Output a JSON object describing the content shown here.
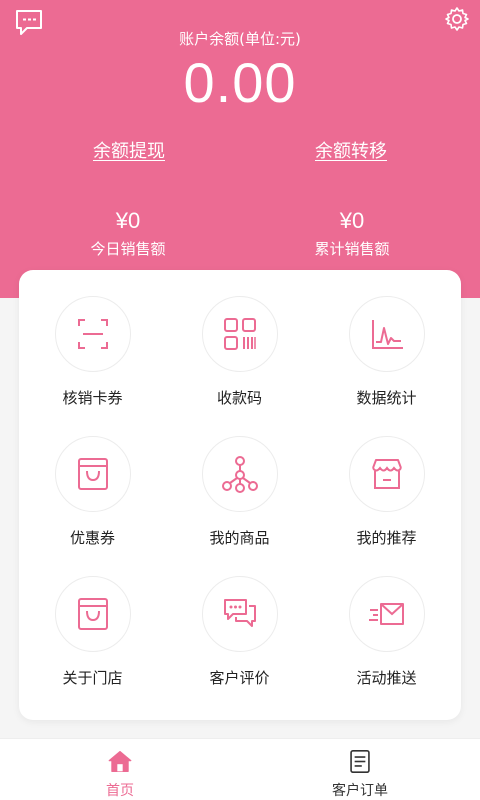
{
  "colors": {
    "accent": "#ec6b93",
    "background": "#f5f5f5",
    "card": "#ffffff",
    "text": "#333333"
  },
  "header": {
    "message_icon": "chat-icon",
    "settings_icon": "gear-icon",
    "balance_label": "账户余额(单位:元)",
    "balance_value": "0.00",
    "withdraw_label": "余额提现",
    "transfer_label": "余额转移",
    "today_sales_value": "¥0",
    "today_sales_label": "今日销售额",
    "total_sales_value": "¥0",
    "total_sales_label": "累计销售额"
  },
  "grid": {
    "items": [
      {
        "label": "核销卡券",
        "icon": "scan-icon"
      },
      {
        "label": "收款码",
        "icon": "qrcode-icon"
      },
      {
        "label": "数据统计",
        "icon": "chart-icon"
      },
      {
        "label": "优惠券",
        "icon": "bag-icon"
      },
      {
        "label": "我的商品",
        "icon": "network-icon"
      },
      {
        "label": "我的推荐",
        "icon": "shop-icon"
      },
      {
        "label": "关于门店",
        "icon": "bag-icon"
      },
      {
        "label": "客户评价",
        "icon": "comment-icon"
      },
      {
        "label": "活动推送",
        "icon": "send-mail-icon"
      }
    ]
  },
  "tabbar": {
    "tabs": [
      {
        "label": "首页",
        "icon": "home-icon",
        "active": true
      },
      {
        "label": "客户订单",
        "icon": "document-icon",
        "active": false
      }
    ]
  }
}
